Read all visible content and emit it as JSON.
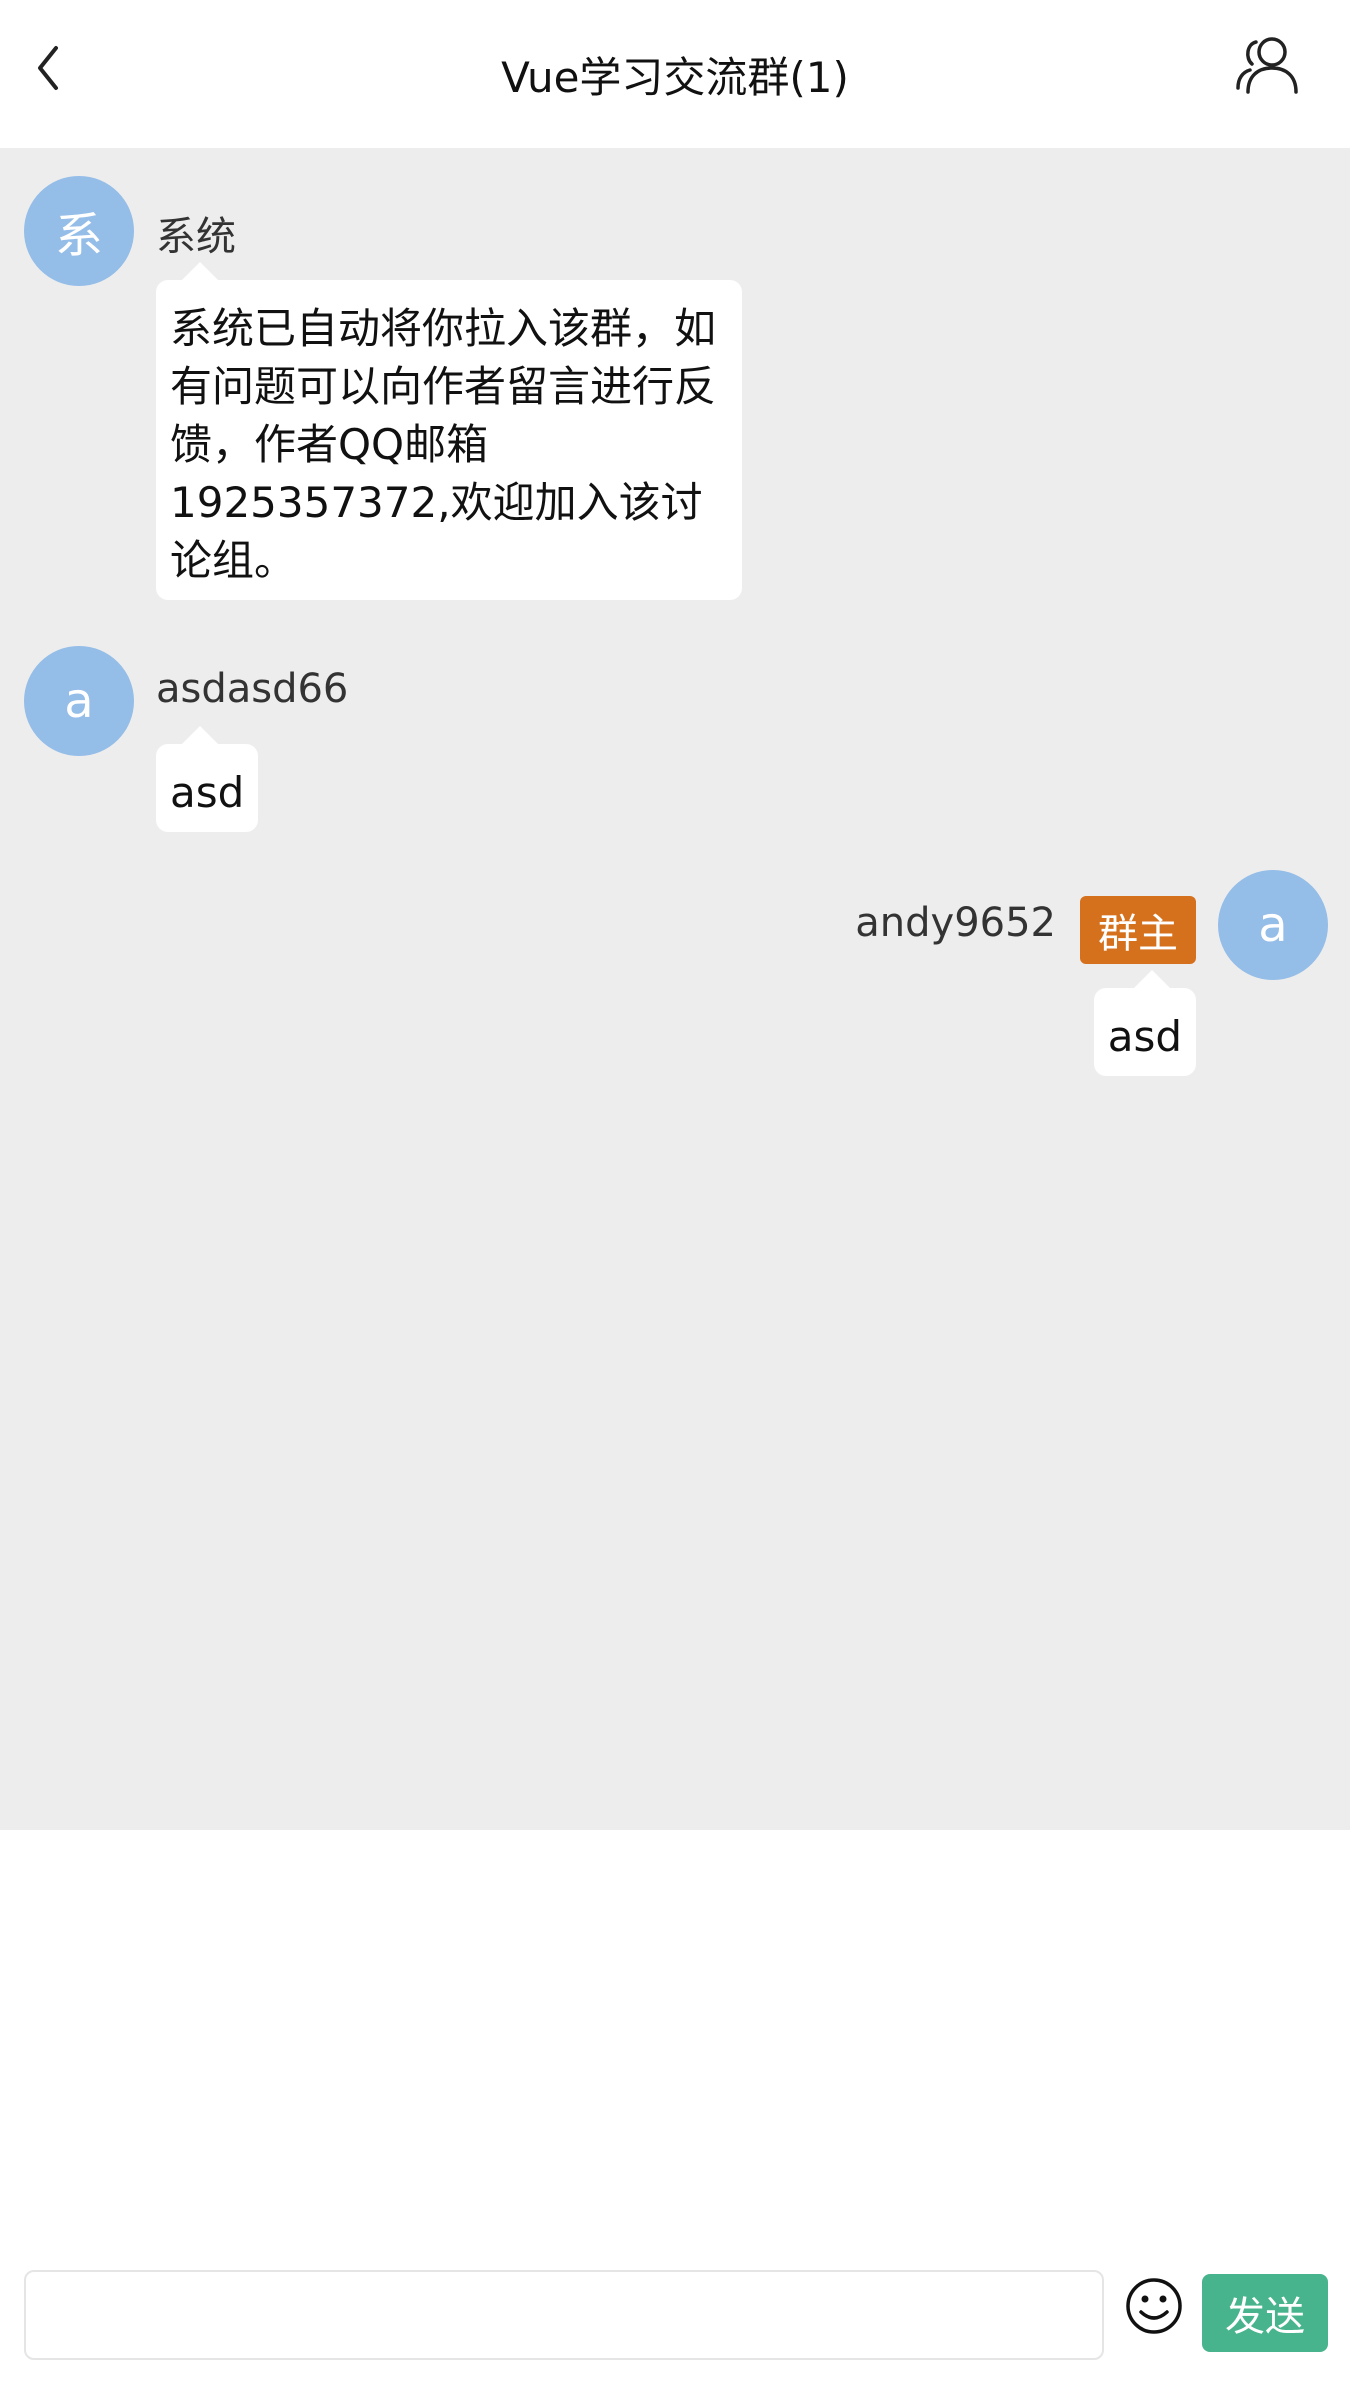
{
  "header": {
    "title": "Vue学习交流群(1)",
    "back_icon": "chevron-left-icon",
    "members_icon": "group-users-icon"
  },
  "messages": [
    {
      "avatar_text": "系",
      "sender": "系统",
      "text": "系统已自动将你拉入该群，如有问题可以向作者留言进行反馈，作者QQ邮箱1925357372,欢迎加入该讨论组。",
      "side": "left"
    },
    {
      "avatar_text": "a",
      "sender": "asdasd66",
      "text": "asd",
      "side": "left"
    },
    {
      "avatar_text": "a",
      "sender": "andy9652",
      "badge": "群主",
      "text": "asd",
      "side": "right"
    }
  ],
  "input": {
    "value": "",
    "placeholder": ""
  },
  "emoji_icon": "smiley-icon",
  "send_label": "发送",
  "colors": {
    "avatar": "#94bde8",
    "chat_background": "#ededed",
    "owner_badge": "#d5711d",
    "send_button": "#47b48d"
  }
}
